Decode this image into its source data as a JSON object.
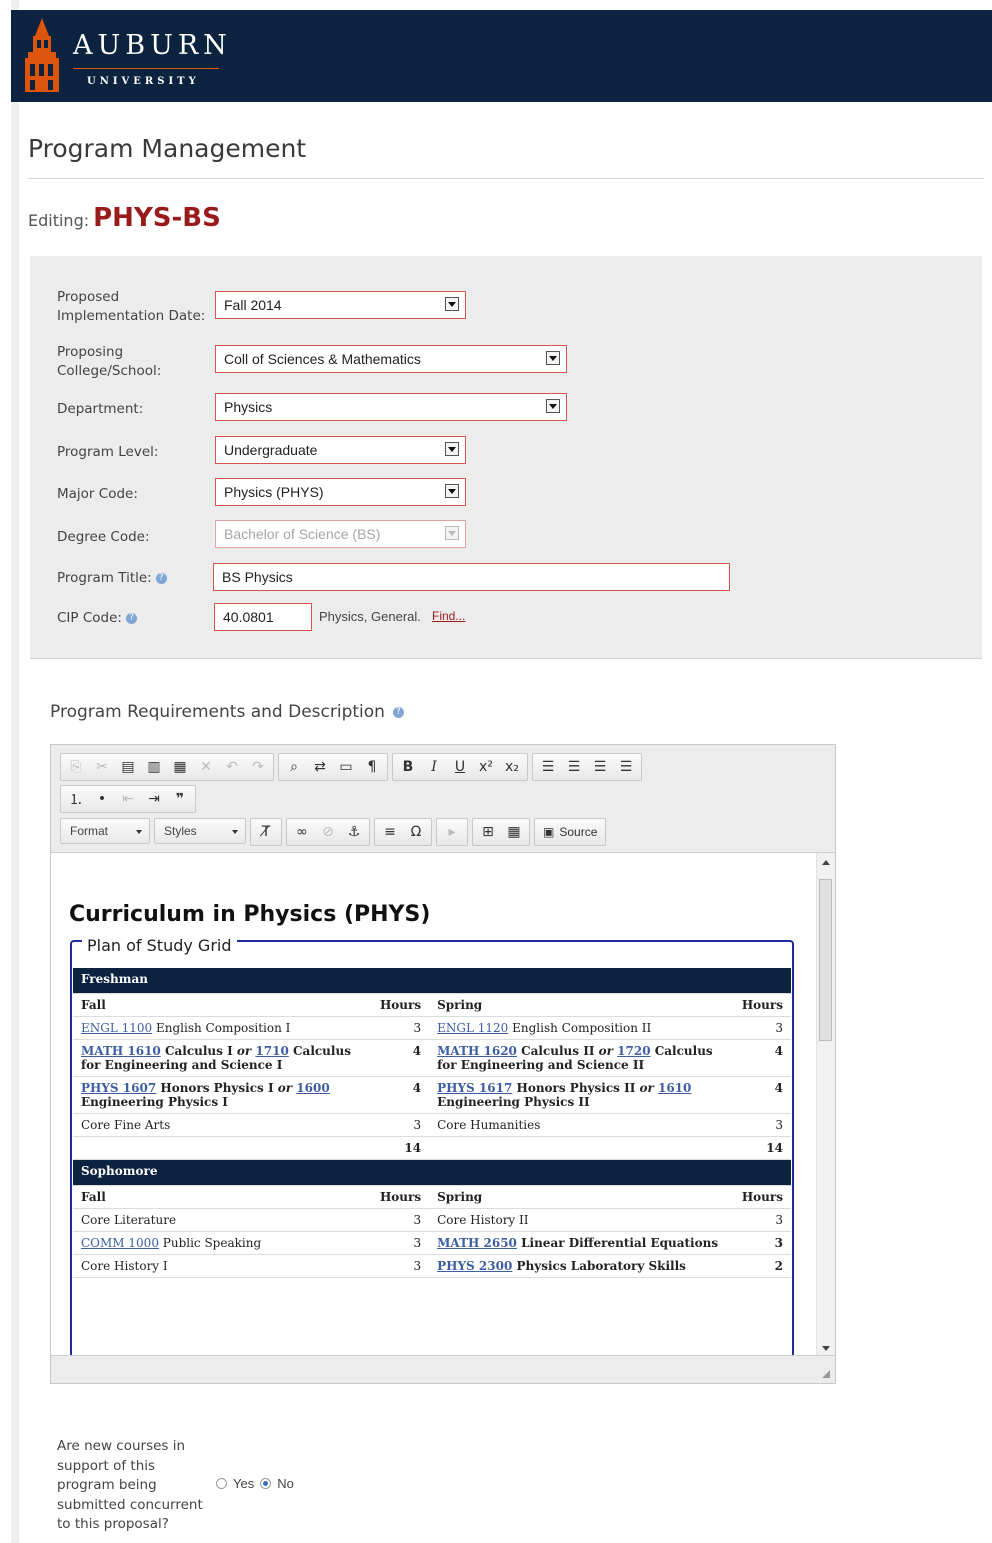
{
  "header": {
    "brand": "AUBURN",
    "subbrand": "UNIVERSITY"
  },
  "page": {
    "title": "Program Management",
    "editing_label": "Editing:",
    "program_code": "PHYS-BS"
  },
  "form": {
    "impl_date": {
      "label": "Proposed Implementation Date:",
      "value": "Fall 2014"
    },
    "college": {
      "label": "Proposing College/School:",
      "value": "Coll of Sciences & Mathematics"
    },
    "department": {
      "label": "Department:",
      "value": "Physics"
    },
    "level": {
      "label": "Program Level:",
      "value": "Undergraduate"
    },
    "major": {
      "label": "Major Code:",
      "value": "Physics (PHYS)"
    },
    "degree": {
      "label": "Degree Code:",
      "value": "Bachelor of Science (BS)"
    },
    "title": {
      "label": "Program Title:",
      "value": "BS Physics"
    },
    "cip": {
      "label": "CIP Code:",
      "value": "40.0801",
      "description": "Physics, General.",
      "find": "Find..."
    }
  },
  "requirements": {
    "title": "Program Requirements and Description",
    "toolbar": {
      "format": "Format",
      "styles": "Styles",
      "source": "Source"
    },
    "content": {
      "heading": "Curriculum in Physics (PHYS)",
      "legend": "Plan of Study Grid",
      "fall": "Fall",
      "spring": "Spring",
      "hours": "Hours",
      "years": [
        {
          "name": "Freshman",
          "rows": [
            {
              "f_code": "ENGL 1100",
              "f_rest": " English Composition I",
              "f_h": "3",
              "s_code": "ENGL 1120",
              "s_rest": " English Composition II",
              "s_h": "3"
            },
            {
              "f_code": "MATH 1610",
              "f_rest": " Calculus I ",
              "f_or": "or",
              "f_code2": "1710",
              "f_rest2": " Calculus for Engineering and Science I",
              "f_h": "4",
              "s_code": "MATH 1620",
              "s_rest": " Calculus II ",
              "s_or": "or",
              "s_code2": "1720",
              "s_rest2": " Calculus for Engineering and Science II",
              "s_h": "4"
            },
            {
              "f_code": "PHYS 1607",
              "f_rest": " Honors Physics I ",
              "f_or": "or",
              "f_code2": "1600",
              "f_rest2": " Engineering Physics I",
              "f_h": "4",
              "s_code": "PHYS 1617",
              "s_rest": " Honors Physics II ",
              "s_or": "or",
              "s_code2": "1610",
              "s_rest2": " Engineering Physics II",
              "s_h": "4"
            },
            {
              "f_text": "Core Fine Arts",
              "f_h": "3",
              "s_text": "Core Humanities",
              "s_h": "3"
            }
          ],
          "total_fall": "14",
          "total_spring": "14"
        },
        {
          "name": "Sophomore",
          "rows": [
            {
              "f_text": "Core Literature",
              "f_h": "3",
              "s_text": "Core History II",
              "s_h": "3"
            },
            {
              "f_code": "COMM 1000",
              "f_rest": " Public Speaking",
              "f_h": "3",
              "s_code": "MATH 2650",
              "s_rest": " Linear Differential Equations",
              "s_h": "3"
            },
            {
              "f_text": "Core History I",
              "f_h": "3",
              "s_code": "PHYS 2300",
              "s_rest": " Physics Laboratory Skills",
              "s_h": "2"
            }
          ]
        }
      ]
    }
  },
  "question": {
    "label": "Are new courses in support of this program being submitted concurrent to this proposal?",
    "yes": "Yes",
    "no": "No",
    "selected": "No"
  },
  "colors": {
    "navy": "#0c2340",
    "orange": "#dd550c",
    "maroon": "#9a1b1b",
    "link": "#3d5ea3"
  }
}
